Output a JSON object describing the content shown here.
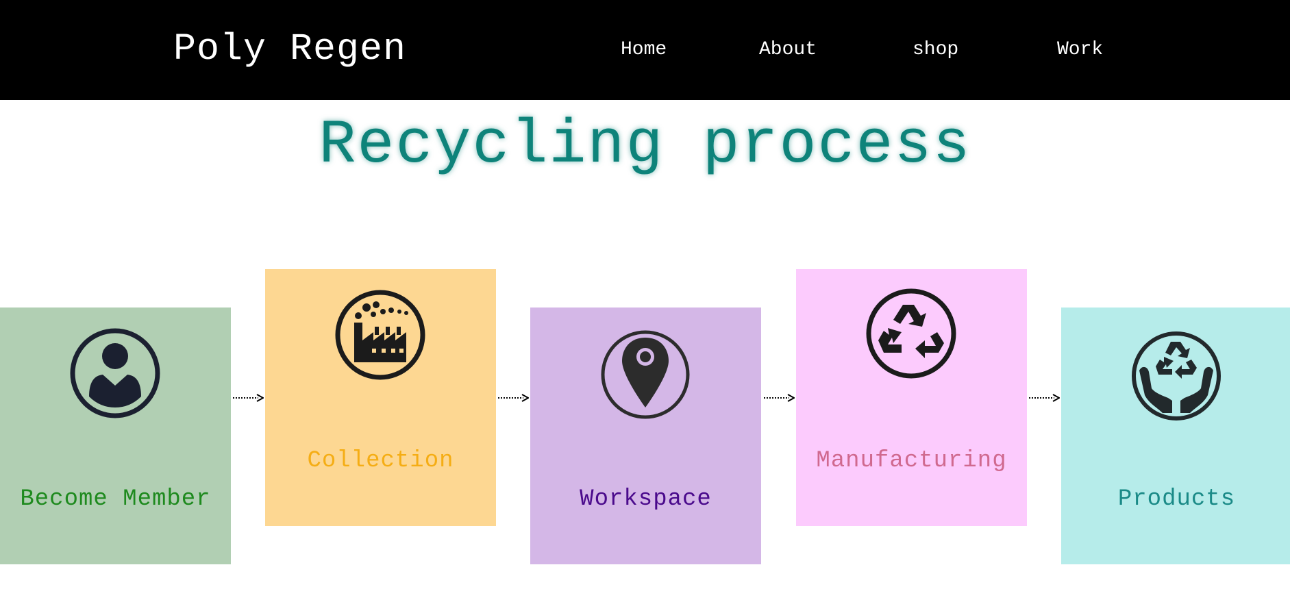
{
  "header": {
    "brand": "Poly Regen",
    "nav": [
      {
        "label": "Home"
      },
      {
        "label": "About"
      },
      {
        "label": "shop"
      },
      {
        "label": "Work"
      }
    ]
  },
  "main": {
    "title": "Recycling process",
    "steps": [
      {
        "label": "Become Member",
        "icon": "member-icon",
        "bg": "#b1cfb3",
        "color": "#1e8a1e"
      },
      {
        "label": "Collection",
        "icon": "factory-icon",
        "bg": "#fdd792",
        "color": "#f5ad14"
      },
      {
        "label": "Workspace",
        "icon": "location-pin-icon",
        "bg": "#d4b7e7",
        "color": "#4a0a8c"
      },
      {
        "label": "Manufacturing",
        "icon": "recycle-icon",
        "bg": "#fccbfd",
        "color": "#d0698f"
      },
      {
        "label": "Products",
        "icon": "recycle-hands-icon",
        "bg": "#b6ecea",
        "color": "#1a8a87"
      }
    ]
  }
}
